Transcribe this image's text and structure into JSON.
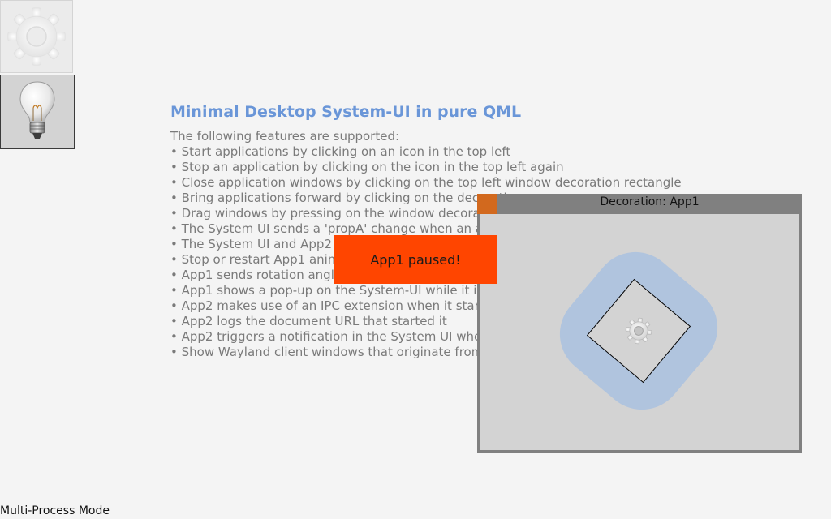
{
  "launcher": {
    "apps": [
      {
        "id": "app1",
        "icon": "gear-icon",
        "running": true
      },
      {
        "id": "app2",
        "icon": "lightbulb-icon",
        "running": false
      }
    ]
  },
  "info": {
    "title": "Minimal Desktop System-UI in pure QML",
    "intro": "The following features are supported:",
    "features": [
      "• Start applications by clicking on an icon in the top left",
      "• Stop an application by clicking on the icon in the top left again",
      "• Close application windows by clicking on the top left window decoration rectangle",
      "• Bring applications forward by clicking on the decoration",
      "• Drag windows by pressing on the window decoration",
      "• The System UI sends a 'propA' change when an app",
      "• The System UI and App2 re",
      "• Stop or restart App1 anima",
      "• App1 sends rotation angle",
      "• App1 shows a pop-up on the System-UI while it is pa",
      "• App2 makes use of an IPC extension when it starts",
      "• App2 logs the document URL that started it",
      "• App2 triggers a notification in the System UI when",
      "• Show Wayland client windows that originate from p"
    ]
  },
  "popup": {
    "text": "App1 paused!",
    "color": "#ff4500"
  },
  "app1_window": {
    "decoration_title": "Decoration: App1",
    "close_color": "#d2691e",
    "decoration_color": "#808080",
    "content_color": "#d3d3d3",
    "blob_color": "#b0c4de",
    "icon": "gear-icon"
  },
  "footer": {
    "mode": "Multi-Process Mode"
  }
}
